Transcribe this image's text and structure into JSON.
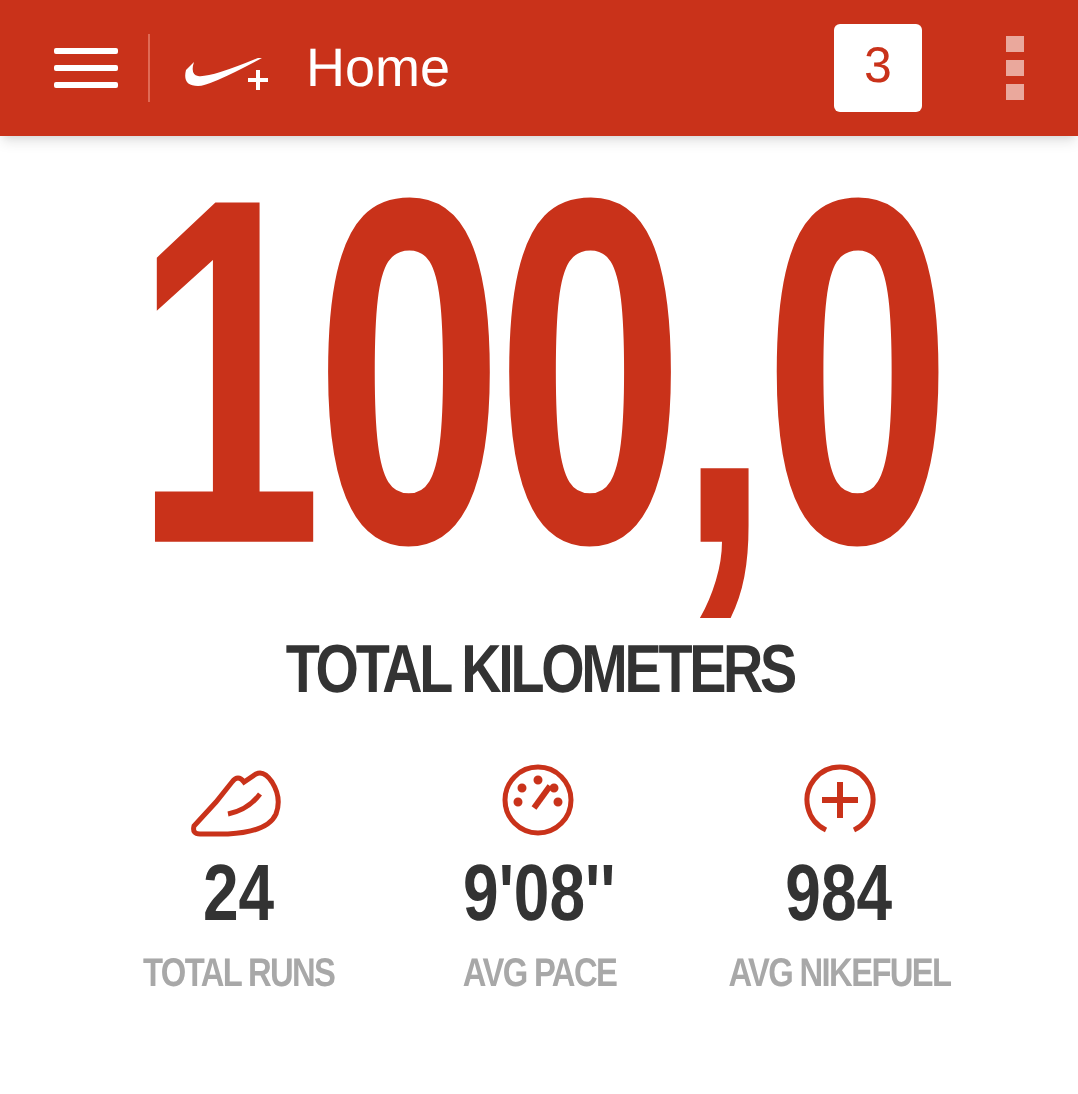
{
  "app_bar": {
    "title": "Home",
    "notification_count": "3"
  },
  "total": {
    "value": "100,0",
    "label": "TOTAL KILOMETERS"
  },
  "stats": [
    {
      "kind": "shoe",
      "value": "24",
      "label": "TOTAL RUNS"
    },
    {
      "kind": "gauge",
      "value": "9'08''",
      "label": "AVG PACE"
    },
    {
      "kind": "fuel",
      "value": "984",
      "label": "AVG NIKEFUEL"
    }
  ]
}
